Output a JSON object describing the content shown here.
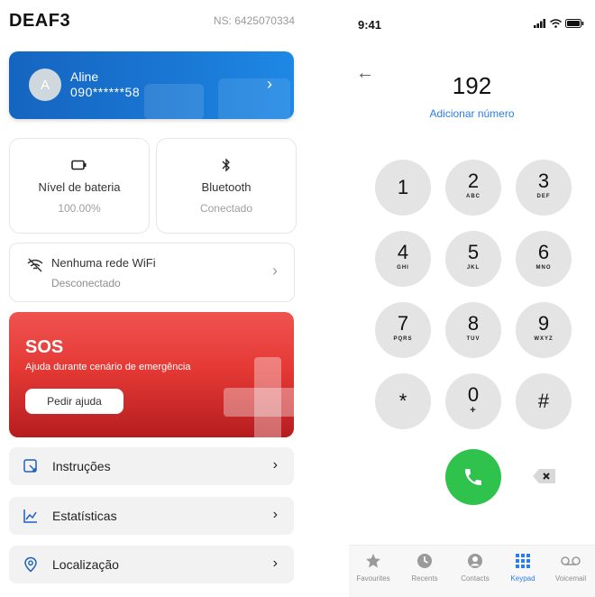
{
  "left_app": {
    "title": "DEAF3",
    "serial": "NS: 6425070334",
    "user": {
      "initial": "A",
      "name": "Aline",
      "phone": "090******58"
    },
    "battery": {
      "title": "Nível de bateria",
      "value": "100.00%"
    },
    "bluetooth": {
      "title": "Bluetooth",
      "value": "Conectado"
    },
    "wifi": {
      "title": "Nenhuma rede WiFi",
      "status": "Desconectado"
    },
    "sos": {
      "title": "SOS",
      "subtitle": "Ajuda durante cenário de emergência",
      "button": "Pedir ajuda"
    },
    "menu": [
      {
        "label": "Instruções",
        "icon": "instructions-icon"
      },
      {
        "label": "Estatísticas",
        "icon": "stats-icon"
      },
      {
        "label": "Localização",
        "icon": "location-icon"
      }
    ],
    "colors": {
      "blue": "#1976d2",
      "red": "#e53935"
    }
  },
  "dialer": {
    "time": "9:41",
    "number": "192",
    "add_number": "Adicionar número",
    "keys": [
      {
        "digit": "1",
        "letters": ""
      },
      {
        "digit": "2",
        "letters": "ABC"
      },
      {
        "digit": "3",
        "letters": "DEF"
      },
      {
        "digit": "4",
        "letters": "GHI"
      },
      {
        "digit": "5",
        "letters": "JKL"
      },
      {
        "digit": "6",
        "letters": "MNO"
      },
      {
        "digit": "7",
        "letters": "PQRS"
      },
      {
        "digit": "8",
        "letters": "TUV"
      },
      {
        "digit": "9",
        "letters": "WXYZ"
      },
      {
        "digit": "*",
        "letters": ""
      },
      {
        "digit": "0",
        "letters": "+"
      },
      {
        "digit": "#",
        "letters": ""
      }
    ],
    "tabs": [
      {
        "label": "Favourites",
        "icon": "star-icon"
      },
      {
        "label": "Recents",
        "icon": "clock-icon"
      },
      {
        "label": "Contacts",
        "icon": "contact-icon"
      },
      {
        "label": "Keypad",
        "icon": "keypad-icon",
        "active": true
      },
      {
        "label": "Voicemail",
        "icon": "voicemail-icon"
      }
    ],
    "colors": {
      "call": "#2fc34e",
      "link": "#2b7de9"
    }
  }
}
